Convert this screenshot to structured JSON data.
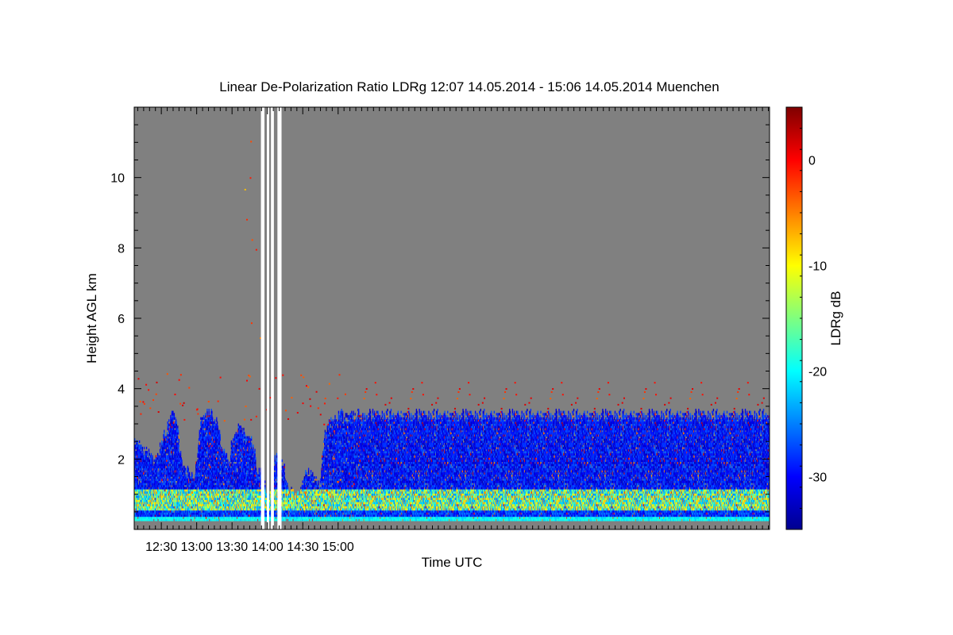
{
  "chart_data": {
    "type": "heatmap",
    "title": "Linear De-Polarization Ratio LDRg   12:07 14.05.2014 - 15:06 14.05.2014 Muenchen",
    "xlabel": "Time UTC",
    "ylabel": "Height AGL km",
    "colorbar_label": "LDRg dB",
    "x_range_min": [
      727,
      1266
    ],
    "x_tick_minutes": [
      750,
      780,
      810,
      840,
      870,
      900
    ],
    "x_tick_labels": [
      "12:30",
      "13:00",
      "13:30",
      "14:00",
      "14:30",
      "15:00"
    ],
    "ylim": [
      0,
      12
    ],
    "y_ticks": [
      2,
      4,
      6,
      8,
      10
    ],
    "y_tick_labels": [
      "2",
      "4",
      "6",
      "8",
      "10"
    ],
    "colorbar_range": [
      -35,
      5
    ],
    "colorbar_ticks": [
      0,
      -10,
      -20,
      -30
    ],
    "colorbar_tick_labels": [
      "0",
      "-10",
      "-20",
      "-30"
    ],
    "colormap": "jet",
    "background_color": "#808080",
    "cloud_tops_km": [
      [
        727,
        2.6
      ],
      [
        733,
        2.3
      ],
      [
        740,
        2.0
      ],
      [
        745,
        1.9
      ],
      [
        752,
        2.6
      ],
      [
        758,
        3.3
      ],
      [
        763,
        2.9
      ],
      [
        767,
        1.8
      ],
      [
        772,
        1.6
      ],
      [
        778,
        1.5
      ],
      [
        783,
        3.0
      ],
      [
        790,
        3.3
      ],
      [
        796,
        3.1
      ],
      [
        801,
        2.3
      ],
      [
        806,
        1.9
      ],
      [
        812,
        2.8
      ],
      [
        818,
        2.8
      ],
      [
        824,
        2.7
      ],
      [
        827,
        2.4
      ],
      [
        832,
        1.5
      ],
      [
        836,
        1.9
      ],
      [
        838,
        0.9
      ],
      [
        843,
        0.9
      ],
      [
        846,
        2.1
      ],
      [
        852,
        2.1
      ],
      [
        856,
        1.2
      ],
      [
        862,
        0.9
      ],
      [
        866,
        0.9
      ],
      [
        872,
        1.6
      ],
      [
        878,
        1.5
      ],
      [
        884,
        1.2
      ],
      [
        888,
        2.7
      ],
      [
        895,
        3.1
      ],
      [
        902,
        3.2
      ]
    ],
    "data_gaps": [
      {
        "start_min": 834.5,
        "end_min": 837.5
      },
      {
        "start_min": 839.5,
        "end_min": 841.5
      },
      {
        "start_min": 843.0,
        "end_min": 845.5
      },
      {
        "start_min": 848.5,
        "end_min": 852.0
      }
    ]
  }
}
